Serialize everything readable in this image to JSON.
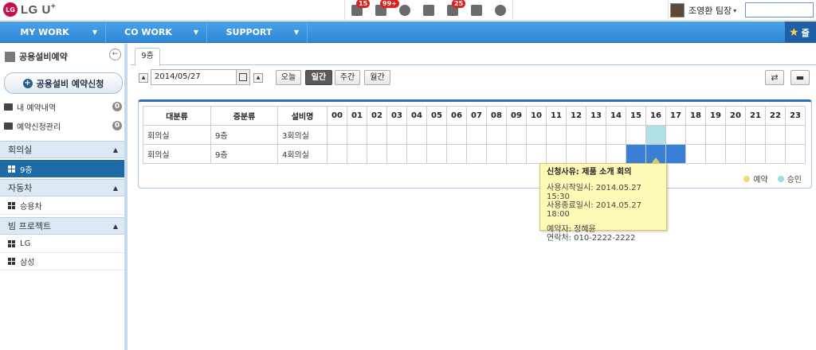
{
  "header": {
    "logo_mark": "LG",
    "logo_text": "LG U",
    "logo_sup": "+",
    "icons": [
      {
        "name": "mail-icon",
        "badge": "15"
      },
      {
        "name": "flag-icon",
        "badge": "99+"
      },
      {
        "name": "chat-icon",
        "badge": ""
      },
      {
        "name": "memo-icon",
        "badge": ""
      },
      {
        "name": "calendar-icon",
        "badge": "25"
      },
      {
        "name": "card-icon",
        "badge": ""
      },
      {
        "name": "add-user-icon",
        "badge": ""
      }
    ],
    "user_name": "조영환 팀장",
    "caret": "▾"
  },
  "nav": {
    "items": [
      {
        "label": "MY WORK",
        "caret": "▼"
      },
      {
        "label": "CO WORK",
        "caret": "▼"
      },
      {
        "label": "SUPPORT",
        "caret": "▼"
      }
    ],
    "favorites_label": "즐"
  },
  "sidebar": {
    "title": "공용설비예약",
    "reserve_button": "공용설비 예약신청",
    "links": [
      {
        "label": "내 예약내역",
        "count": "0"
      },
      {
        "label": "예약신청관리",
        "count": "0"
      }
    ],
    "groups": [
      {
        "label": "회의실",
        "toggle": "▲",
        "items": [
          {
            "label": "9층",
            "active": true
          }
        ]
      },
      {
        "label": "자동차",
        "toggle": "▲",
        "items": [
          {
            "label": "승용차",
            "active": false
          }
        ]
      },
      {
        "label": "빔 프로젝트",
        "toggle": "▲",
        "items": [
          {
            "label": "LG",
            "active": false
          },
          {
            "label": "삼성",
            "active": false
          }
        ]
      }
    ]
  },
  "main": {
    "tab": "9층",
    "date": "2014/05/27",
    "views": [
      {
        "label": "오늘",
        "active": false
      },
      {
        "label": "일간",
        "active": true
      },
      {
        "label": "주간",
        "active": false
      },
      {
        "label": "월간",
        "active": false
      }
    ],
    "table": {
      "headers": [
        "대분류",
        "중분류",
        "설비명"
      ],
      "hours": [
        "00",
        "01",
        "02",
        "03",
        "04",
        "05",
        "06",
        "07",
        "08",
        "09",
        "10",
        "11",
        "12",
        "13",
        "14",
        "15",
        "16",
        "17",
        "18",
        "19",
        "20",
        "21",
        "22",
        "23"
      ],
      "rows": [
        {
          "cat": "회의실",
          "sub": "9층",
          "equip": "3회의실",
          "approved": [
            "16"
          ],
          "reserved": []
        },
        {
          "cat": "회의실",
          "sub": "9층",
          "equip": "4회의실",
          "approved": [],
          "reserved": [
            "15",
            "16",
            "17"
          ]
        }
      ]
    },
    "legend": {
      "reserved": "예약",
      "approved": "승인",
      "reserved_color": "#f2dc6e",
      "approved_color": "#9fdbe3"
    },
    "tooltip": {
      "title": "신청사유: 제품 소개 회의",
      "start": "사용시작일시: 2014.05.27 15:30",
      "end": "사용종료일시: 2014.05.27 18:00",
      "booker": "예약자: 정혜윤",
      "contact": "연락처: 010-2222-2222"
    }
  }
}
